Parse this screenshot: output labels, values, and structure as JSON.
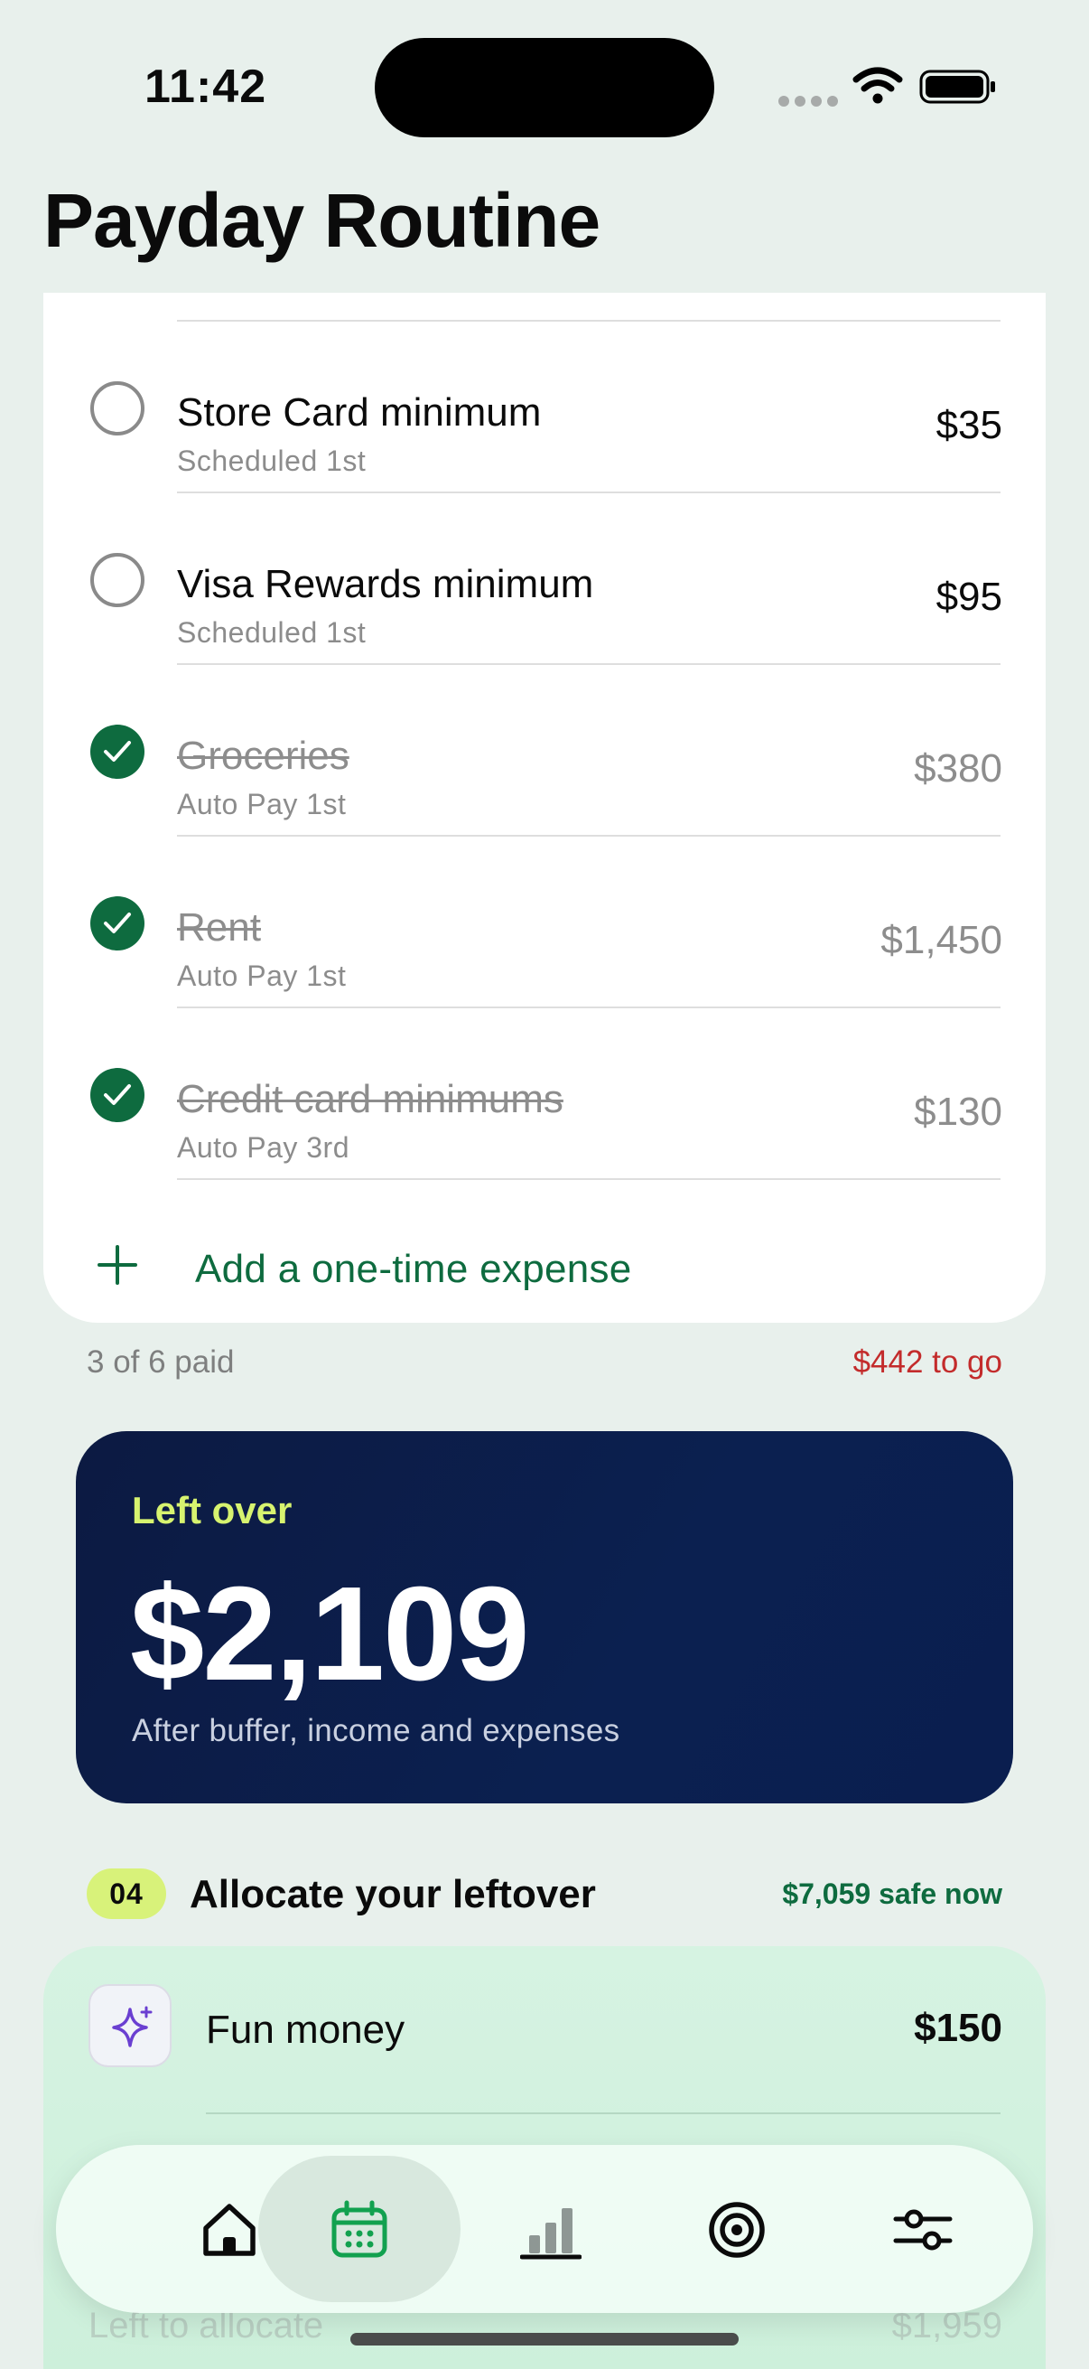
{
  "status_bar": {
    "time": "11:42"
  },
  "page": {
    "title": "Payday Routine"
  },
  "expenses": [
    {
      "name": "Store Card minimum",
      "schedule": "Scheduled 1st",
      "amount": "$35",
      "paid": false
    },
    {
      "name": "Visa Rewards minimum",
      "schedule": "Scheduled 1st",
      "amount": "$95",
      "paid": false
    },
    {
      "name": "Groceries",
      "schedule": "Auto Pay 1st",
      "amount": "$380",
      "paid": true
    },
    {
      "name": "Rent",
      "schedule": "Auto Pay 1st",
      "amount": "$1,450",
      "paid": true
    },
    {
      "name": "Credit card minimums",
      "schedule": "Auto Pay 3rd",
      "amount": "$130",
      "paid": true
    }
  ],
  "add_expense": {
    "label": "Add a one-time expense"
  },
  "summary": {
    "paid": "3 of 6 paid",
    "remaining": "$442 to go"
  },
  "leftover": {
    "label": "Left over",
    "amount": "$2,109",
    "subtitle": "After buffer, income and expenses"
  },
  "step": {
    "number": "04",
    "title": "Allocate your leftover",
    "safe": "$7,059 safe now"
  },
  "allocations": [
    {
      "name": "Fun money",
      "amount": "$150",
      "icon": "sparkle-icon"
    }
  ],
  "partially_hidden": {
    "label": "Left to allocate",
    "amount": "$1,959"
  },
  "tabs": [
    {
      "id": "home",
      "icon": "home-icon",
      "active": false
    },
    {
      "id": "calendar",
      "icon": "calendar-icon",
      "active": true
    },
    {
      "id": "stats",
      "icon": "bar-chart-icon",
      "active": false
    },
    {
      "id": "goals",
      "icon": "target-icon",
      "active": false
    },
    {
      "id": "settings",
      "icon": "sliders-icon",
      "active": false
    }
  ],
  "colors": {
    "background": "#e8f0ec",
    "accent_green": "#0e6b3f",
    "warning_red": "#c32b2b",
    "navy": "#0b2050",
    "lime": "#d8f27a",
    "mint": "#d6f3e2"
  }
}
